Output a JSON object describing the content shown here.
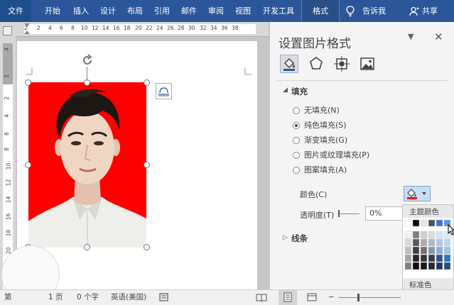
{
  "ribbon": {
    "tabs": [
      "文件",
      "开始",
      "插入",
      "设计",
      "布局",
      "引用",
      "邮件",
      "审阅",
      "视图",
      "开发工具",
      "格式"
    ],
    "tell_me": "告诉我",
    "share": "共享"
  },
  "ruler": {
    "top_ticks": [
      "2",
      "2",
      "4",
      "6",
      "8",
      "10",
      "12",
      "14",
      "16",
      "18",
      "20",
      "22",
      "24",
      "26",
      "28",
      "30",
      "32",
      "34",
      "36",
      "38"
    ],
    "left_ticks": [
      "4",
      "2",
      "2",
      "4",
      "6",
      "8",
      "10",
      "12",
      "14",
      "16",
      "18",
      "20"
    ]
  },
  "panel": {
    "title": "设置图片格式",
    "fill_section": "填充",
    "options": [
      "无填充(N)",
      "纯色填充(S)",
      "渐变填充(G)",
      "图片或纹理填充(P)",
      "图案填充(A)"
    ],
    "selected_option": "纯色填充(S)",
    "color_label": "颜色(C)",
    "transparency_label": "透明度(T)",
    "transparency_value": "0%",
    "line_section": "线条"
  },
  "color_dropdown": {
    "theme_label": "主题颜色",
    "standard_label": "标准色"
  },
  "status": {
    "pages": "1 页",
    "words": "0 个字",
    "language": "英语(美国)",
    "page_prefix": "第"
  },
  "colors": {
    "ribbon": "#2b579a",
    "photo_background": "#ff0000",
    "accent_blue": "#2b579a"
  }
}
